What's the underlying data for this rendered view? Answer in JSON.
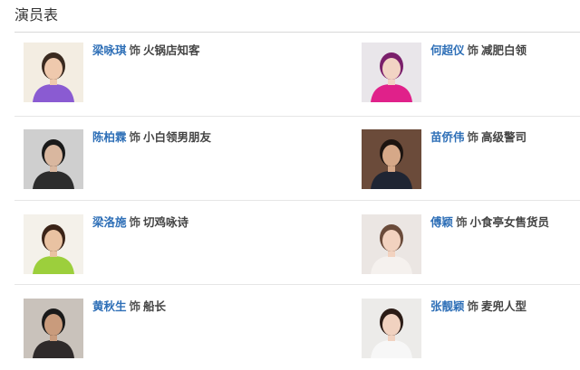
{
  "section": {
    "title": "演员表"
  },
  "cast": [
    {
      "actor": "梁咏琪",
      "as": "饰",
      "role": "火锅店知客",
      "photo_icon": "actor-photo-icon",
      "bg": "#f3ede2",
      "skin": "#efc9ad",
      "hair": "#3a2a20",
      "top": "#8a5bd2"
    },
    {
      "actor": "何超仪",
      "as": "饰",
      "role": "减肥白领",
      "photo_icon": "actor-photo-icon",
      "bg": "#e9e6ea",
      "skin": "#f2d4c4",
      "hair": "#7a1f6b",
      "top": "#e0218a"
    },
    {
      "actor": "陈柏霖",
      "as": "饰",
      "role": "小白领男朋友",
      "photo_icon": "actor-photo-icon",
      "bg": "#cfcfcf",
      "skin": "#d9b79f",
      "hair": "#1a1a1a",
      "top": "#2c2c2c"
    },
    {
      "actor": "苗侨伟",
      "as": "饰",
      "role": "高级警司",
      "photo_icon": "actor-photo-icon",
      "bg": "#6b4b3a",
      "skin": "#d6a888",
      "hair": "#1c1410",
      "top": "#1f2533"
    },
    {
      "actor": "梁洛施",
      "as": "饰",
      "role": "切鸡咏诗",
      "photo_icon": "actor-photo-icon",
      "bg": "#f4f1ea",
      "skin": "#e9c2a2",
      "hair": "#3b2418",
      "top": "#9ccf3c"
    },
    {
      "actor": "傅颖",
      "as": "饰",
      "role": "小食亭女售货员",
      "photo_icon": "actor-photo-icon",
      "bg": "#ebe6e3",
      "skin": "#f2d2bf",
      "hair": "#6a4b3a",
      "top": "#f5f1ee"
    },
    {
      "actor": "黄秋生",
      "as": "饰",
      "role": "船长",
      "photo_icon": "actor-photo-icon",
      "bg": "#c9c2bb",
      "skin": "#c99b7c",
      "hair": "#1a1a1a",
      "top": "#2f2a2a"
    },
    {
      "actor": "张靓颖",
      "as": "饰",
      "role": "麦兜人型",
      "photo_icon": "actor-photo-icon",
      "bg": "#ecebe9",
      "skin": "#f1d2c0",
      "hair": "#2b1c16",
      "top": "#f7f7f7"
    }
  ]
}
